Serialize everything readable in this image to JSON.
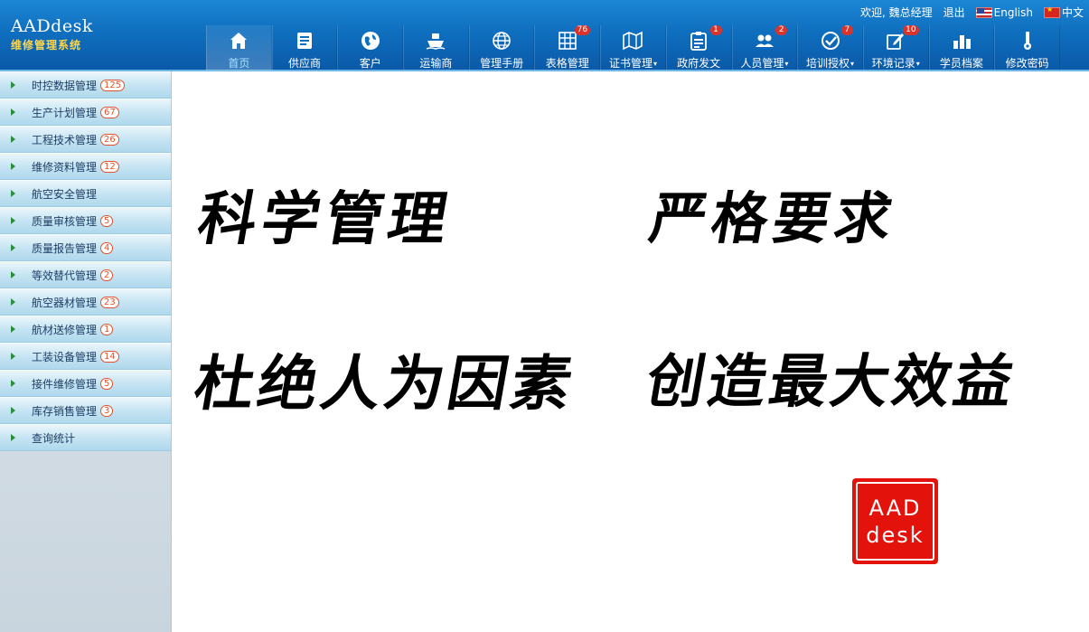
{
  "header": {
    "brand": "AADdesk",
    "subtitle": "维修管理系统",
    "welcome": "欢迎, 魏总经理",
    "logout": "退出",
    "lang_en": "English",
    "lang_zh": "中文"
  },
  "nav": [
    {
      "label": "首页",
      "icon": "home-icon",
      "active": true
    },
    {
      "label": "供应商",
      "icon": "document-icon"
    },
    {
      "label": "客户",
      "icon": "globe-icon"
    },
    {
      "label": "运输商",
      "icon": "ship-icon"
    },
    {
      "label": "管理手册",
      "icon": "world-icon"
    },
    {
      "label": "表格管理",
      "icon": "table-icon",
      "badge": "76"
    },
    {
      "label": "证书管理",
      "icon": "map-icon",
      "dropdown": true
    },
    {
      "label": "政府发文",
      "icon": "clipboard-icon",
      "badge": "1"
    },
    {
      "label": "人员管理",
      "icon": "users-icon",
      "badge": "2",
      "dropdown": true
    },
    {
      "label": "培训授权",
      "icon": "check-circle-icon",
      "badge": "7",
      "dropdown": true
    },
    {
      "label": "环境记录",
      "icon": "edit-icon",
      "badge": "10",
      "dropdown": true
    },
    {
      "label": "学员档案",
      "icon": "bar-chart-icon"
    },
    {
      "label": "修改密码",
      "icon": "key-icon"
    }
  ],
  "sidebar": {
    "items": [
      {
        "label": "时控数据管理",
        "count": "125"
      },
      {
        "label": "生产计划管理",
        "count": "67"
      },
      {
        "label": "工程技术管理",
        "count": "26"
      },
      {
        "label": "维修资料管理",
        "count": "12"
      },
      {
        "label": "航空安全管理",
        "count": ""
      },
      {
        "label": "质量审核管理",
        "count": "5"
      },
      {
        "label": "质量报告管理",
        "count": "4"
      },
      {
        "label": "等效替代管理",
        "count": "2"
      },
      {
        "label": "航空器材管理",
        "count": "23"
      },
      {
        "label": "航材送修管理",
        "count": "1"
      },
      {
        "label": "工装设备管理",
        "count": "14"
      },
      {
        "label": "接件维修管理",
        "count": "5"
      },
      {
        "label": "库存销售管理",
        "count": "3"
      },
      {
        "label": "查询统计",
        "count": ""
      }
    ]
  },
  "content": {
    "slogan1": "科学管理",
    "slogan2": "严格要求",
    "slogan3": "杜绝人为因素",
    "slogan4": "创造最大效益",
    "stamp_line1": "AAD",
    "stamp_line2": "desk"
  },
  "colors": {
    "header_blue": "#0f6fbf",
    "badge_red": "#d8342c",
    "stamp_red": "#e3120b",
    "sidebar_text": "#1d3e66"
  }
}
